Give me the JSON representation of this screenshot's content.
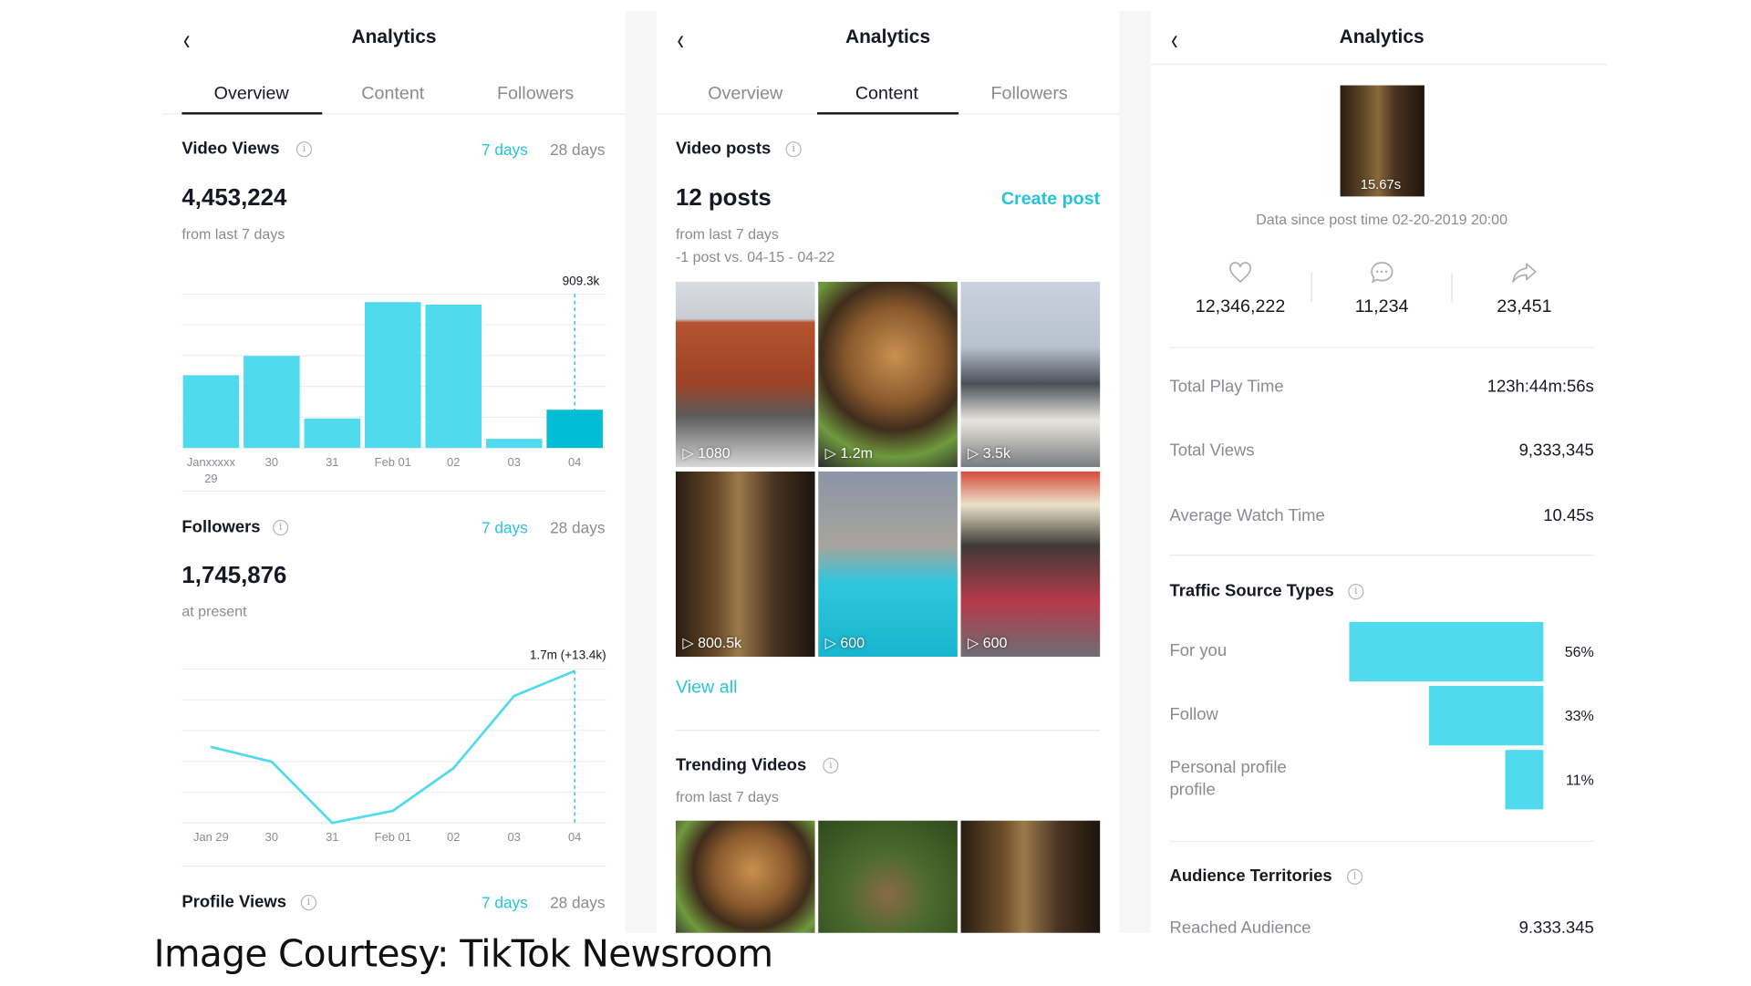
{
  "colors": {
    "accent": "#26c4dc",
    "bar": "#4fdaee",
    "bar_selected": "#00bcd4",
    "text": "#161823",
    "muted": "#8a8b91"
  },
  "caption": "Image Courtesy: TikTok Newsroom",
  "overview_panel": {
    "title": "Analytics",
    "tabs": [
      {
        "label": "Overview",
        "active": true
      },
      {
        "label": "Content",
        "active": false
      },
      {
        "label": "Followers",
        "active": false
      }
    ],
    "video_views": {
      "heading": "Video Views",
      "range_7": "7 days",
      "range_28": "28 days",
      "selected_range": "7 days",
      "value": "4,453,224",
      "caption": "from last 7 days",
      "peak_label": "909.3k"
    },
    "followers": {
      "heading": "Followers",
      "range_7": "7 days",
      "range_28": "28 days",
      "selected_range": "7 days",
      "value": "1,745,876",
      "caption": "at present",
      "peak_label": "1.7m (+13.4k)"
    },
    "profile_views": {
      "heading": "Profile Views",
      "range_7": "7 days",
      "range_28": "28 days",
      "selected_range": "7 days"
    }
  },
  "chart_data": [
    {
      "type": "bar",
      "title": "",
      "categories": [
        "Janxxxxx 29",
        "30",
        "31",
        "Feb 01",
        "02",
        "03",
        "04"
      ],
      "values": [
        1730000,
        2190000,
        700000,
        3470000,
        3410000,
        215000,
        909300
      ],
      "selected_index": 6,
      "ylim": [
        0,
        3660000
      ],
      "grid": true,
      "annotation": "909.3k"
    },
    {
      "type": "line",
      "title": "",
      "categories": [
        "Jan 29",
        "30",
        "31",
        "Feb 01",
        "02",
        "03",
        "04"
      ],
      "values": [
        1704000,
        1696000,
        1663000,
        1669500,
        1692500,
        1731500,
        1745000
      ],
      "selected_index": 6,
      "ylim": [
        1663000,
        1746000
      ],
      "grid": true,
      "annotation": "1.7m (+13.4k)"
    }
  ],
  "content_panel": {
    "title": "Analytics",
    "tabs": [
      {
        "label": "Overview",
        "active": false
      },
      {
        "label": "Content",
        "active": true
      },
      {
        "label": "Followers",
        "active": false
      }
    ],
    "video_posts": {
      "heading": "Video posts",
      "count": "12 posts",
      "create": "Create post",
      "caption1": "from last 7 days",
      "caption2": "-1 post vs. 04-15 - 04-22"
    },
    "posts": [
      {
        "plays": "1080"
      },
      {
        "plays": "1.2m"
      },
      {
        "plays": "3.5k"
      },
      {
        "plays": "800.5k"
      },
      {
        "plays": "600"
      },
      {
        "plays": "600"
      }
    ],
    "view_all": "View all",
    "trending": {
      "heading": "Trending Videos",
      "caption": "from last 7 days"
    }
  },
  "detail_panel": {
    "title": "Analytics",
    "duration": "15.67s",
    "since": "Data since post time 02-20-2019 20:00",
    "stats": [
      {
        "icon": "heart-icon",
        "value": "12,346,222"
      },
      {
        "icon": "comment-icon",
        "value": "11,234"
      },
      {
        "icon": "share-icon",
        "value": "23,451"
      }
    ],
    "rows": [
      {
        "label": "Total Play Time",
        "value": "123h:44m:56s"
      },
      {
        "label": "Total Views",
        "value": "9,333,345"
      },
      {
        "label": "Average Watch Time",
        "value": "10.45s"
      }
    ],
    "traffic": {
      "heading": "Traffic Source Types",
      "items": [
        {
          "label": "For you",
          "pct": 56,
          "text": "56%"
        },
        {
          "label": "Follow",
          "pct": 33,
          "text": "33%"
        },
        {
          "label": "Personal profile profile",
          "pct": 11,
          "text": "11%"
        }
      ]
    },
    "audience": {
      "heading": "Audience Territories",
      "reached_label": "Reached Audience",
      "reached_value": "9,333,345"
    }
  }
}
